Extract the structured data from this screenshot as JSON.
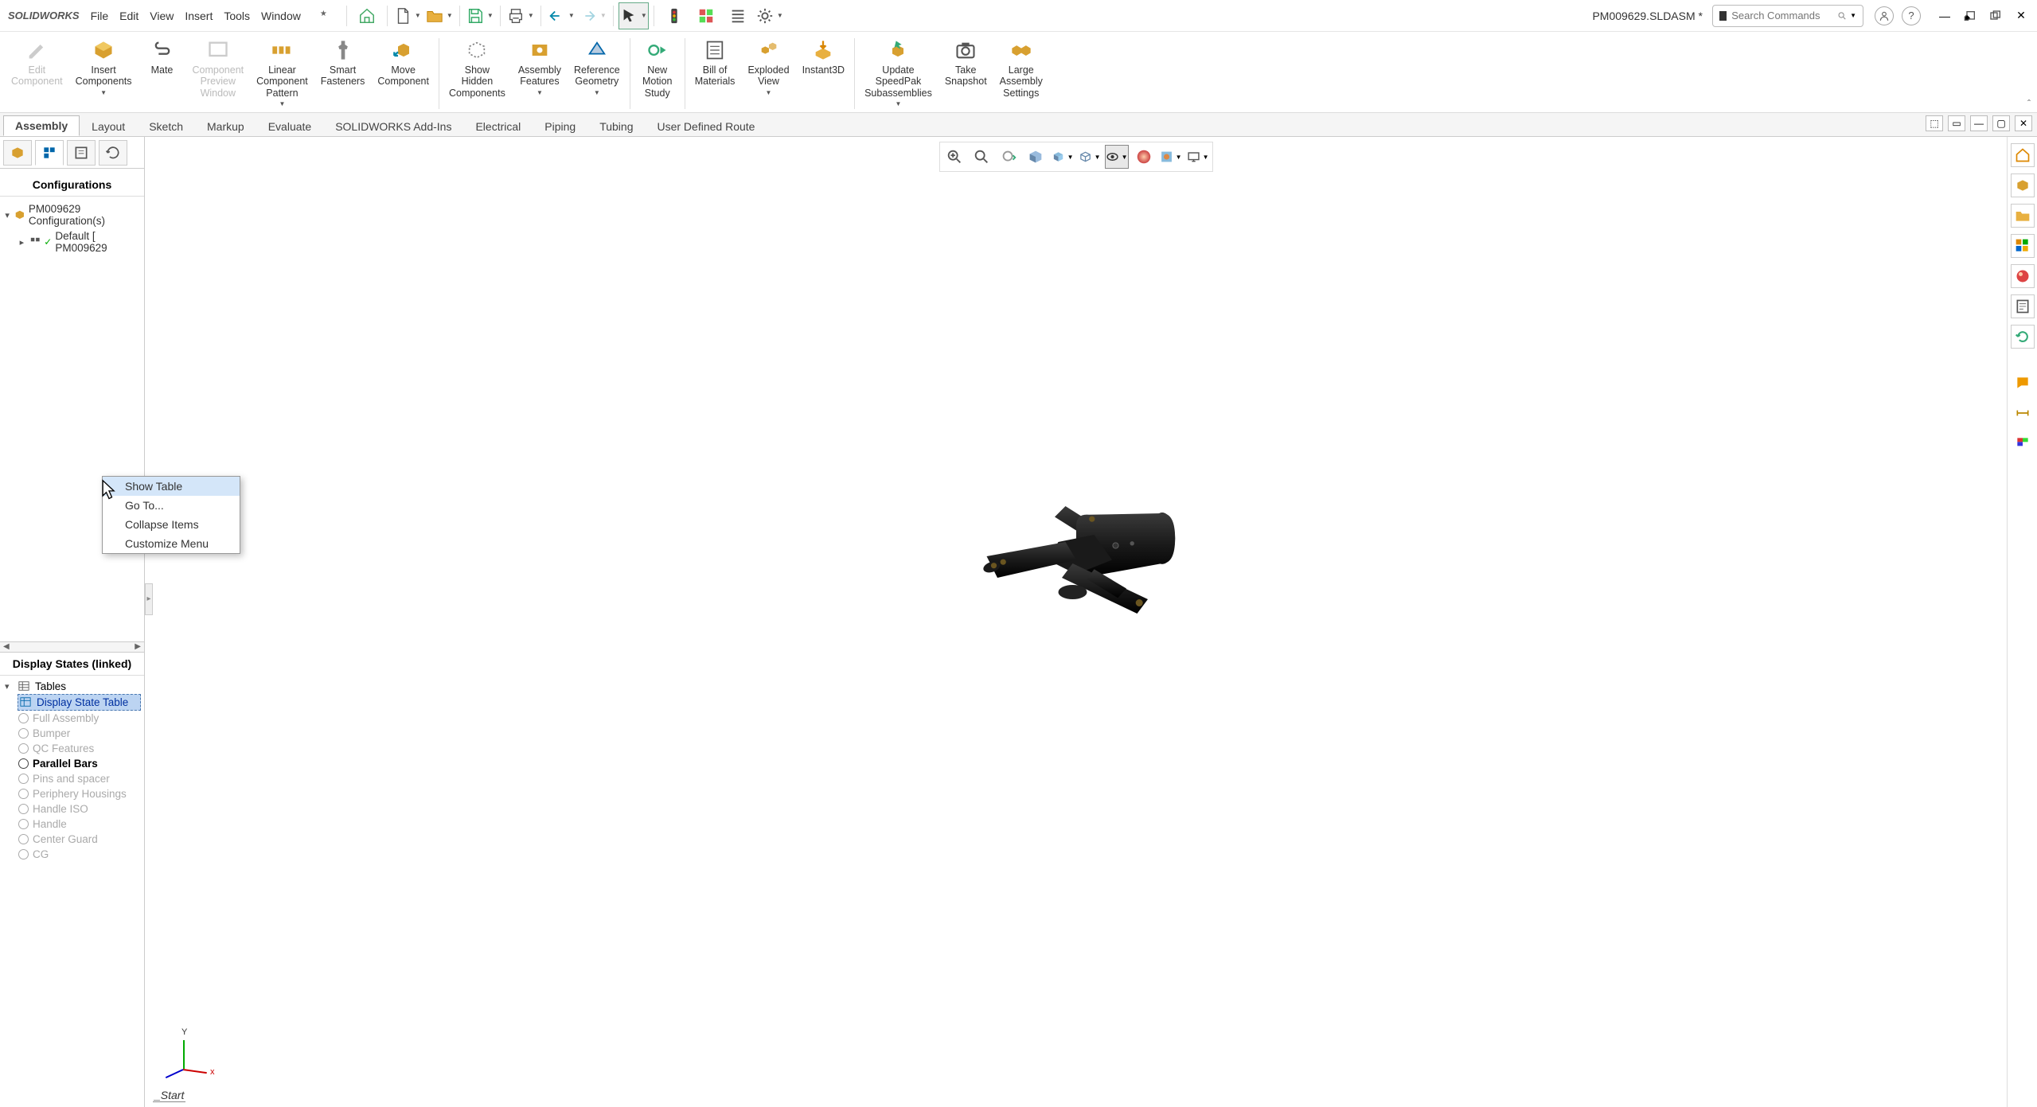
{
  "app_name": "SOLIDWORKS",
  "document_title": "PM009629.SLDASM *",
  "menu": [
    "File",
    "Edit",
    "View",
    "Insert",
    "Tools",
    "Window"
  ],
  "search_placeholder": "Search Commands",
  "ribbon": [
    {
      "label": [
        "Edit",
        "Component"
      ],
      "disabled": true
    },
    {
      "label": [
        "Insert",
        "Components"
      ],
      "dd": true
    },
    {
      "label": [
        "Mate"
      ]
    },
    {
      "label": [
        "Component",
        "Preview",
        "Window"
      ],
      "disabled": true
    },
    {
      "label": [
        "Linear",
        "Component",
        "Pattern"
      ],
      "dd": true
    },
    {
      "label": [
        "Smart",
        "Fasteners"
      ]
    },
    {
      "label": [
        "Move",
        "Component"
      ]
    },
    {
      "label": [
        "Show",
        "Hidden",
        "Components"
      ]
    },
    {
      "label": [
        "Assembly",
        "Features"
      ],
      "dd": true
    },
    {
      "label": [
        "Reference",
        "Geometry"
      ],
      "dd": true
    },
    {
      "label": [
        "New",
        "Motion",
        "Study"
      ]
    },
    {
      "label": [
        "Bill of",
        "Materials"
      ]
    },
    {
      "label": [
        "Exploded",
        "View"
      ],
      "dd": true
    },
    {
      "label": [
        "Instant3D"
      ]
    },
    {
      "label": [
        "Update",
        "SpeedPak",
        "Subassemblies"
      ],
      "dd": true
    },
    {
      "label": [
        "Take",
        "Snapshot"
      ]
    },
    {
      "label": [
        "Large",
        "Assembly",
        "Settings"
      ]
    }
  ],
  "tabs": [
    "Assembly",
    "Layout",
    "Sketch",
    "Markup",
    "Evaluate",
    "SOLIDWORKS Add-Ins",
    "Electrical",
    "Piping",
    "Tubing",
    "User Defined Route"
  ],
  "active_tab": "Assembly",
  "config_panel": {
    "header": "Configurations",
    "root": "PM009629 Configuration(s)",
    "default_config": "Default [ PM009629"
  },
  "display_states": {
    "header": "Display States (linked)",
    "tables_label": "Tables",
    "selected_table": "Display State Table",
    "items": [
      {
        "label": "Full Assembly",
        "active": false
      },
      {
        "label": "Bumper",
        "active": false
      },
      {
        "label": "QC Features",
        "active": false
      },
      {
        "label": "Parallel Bars",
        "active": true
      },
      {
        "label": "Pins and spacer",
        "active": false
      },
      {
        "label": "Periphery Housings",
        "active": false
      },
      {
        "label": "Handle ISO",
        "active": false
      },
      {
        "label": "Handle",
        "active": false
      },
      {
        "label": "Center Guard",
        "active": false
      },
      {
        "label": "CG",
        "active": false
      }
    ]
  },
  "context_menu": [
    "Show Table",
    "Go To...",
    "Collapse Items",
    "Customize Menu"
  ],
  "start_label": "_Start",
  "triad_y": "Y",
  "triad_x": "x"
}
